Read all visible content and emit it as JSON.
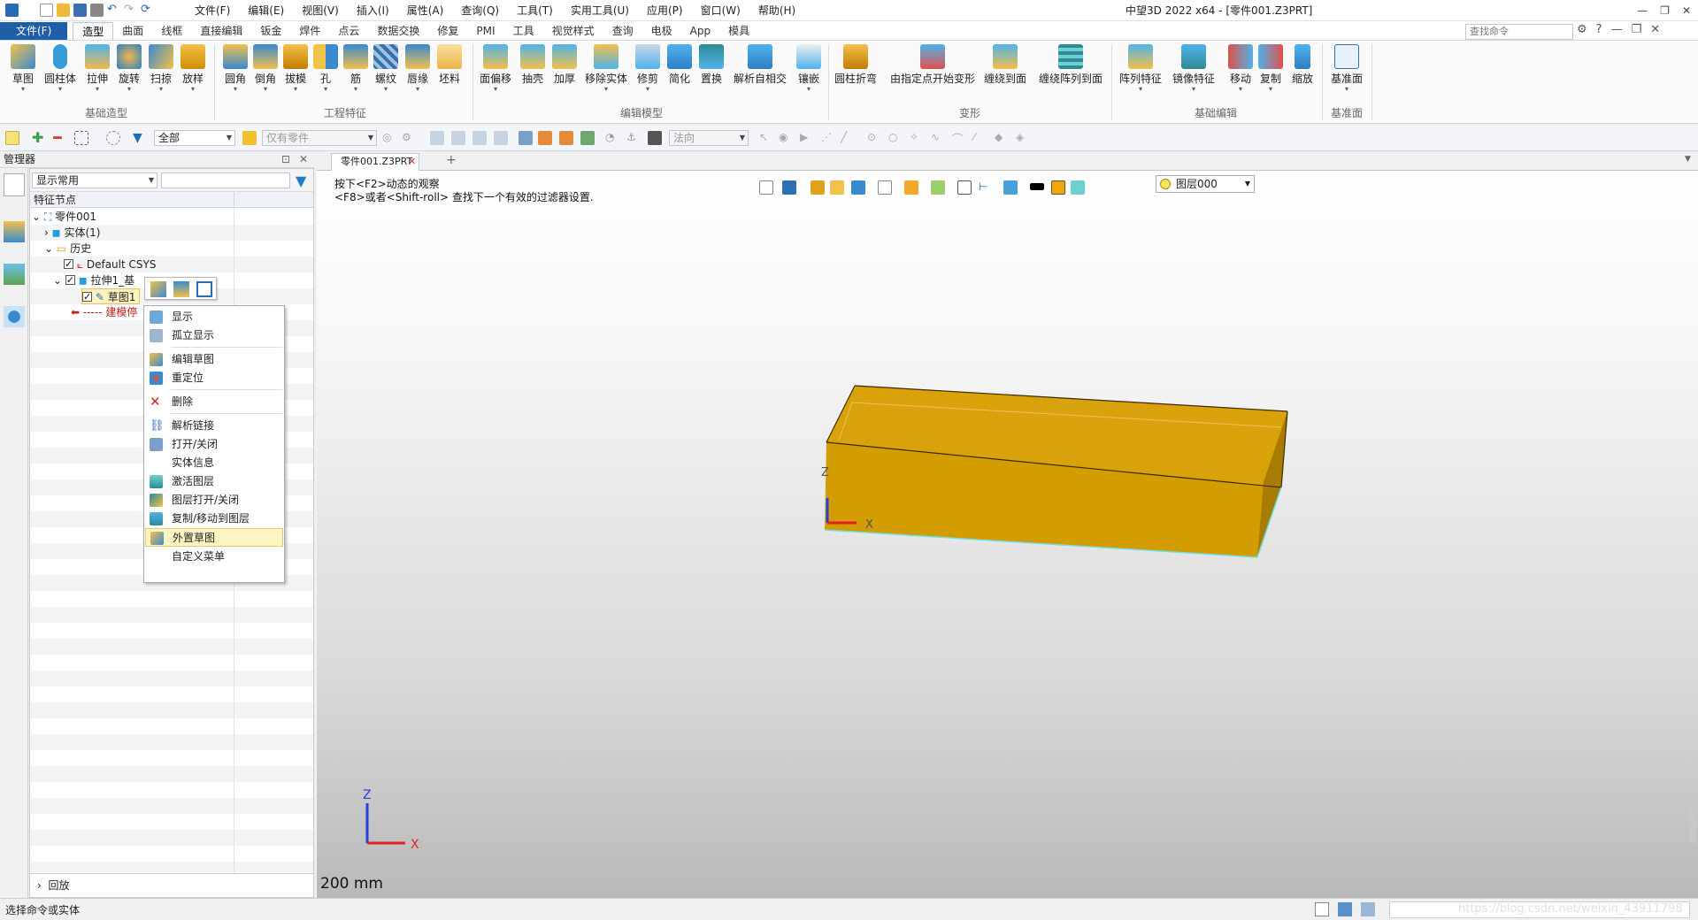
{
  "app": {
    "title": "中望3D 2022 x64 - [零件001.Z3PRT]"
  },
  "menubar": [
    "文件(F)",
    "编辑(E)",
    "视图(V)",
    "插入(I)",
    "属性(A)",
    "查询(Q)",
    "工具(T)",
    "实用工具(U)",
    "应用(P)",
    "窗口(W)",
    "帮助(H)"
  ],
  "ribbon_tabs": [
    "文件(F)",
    "造型",
    "曲面",
    "线框",
    "直接编辑",
    "钣金",
    "焊件",
    "点云",
    "数据交换",
    "修复",
    "PMI",
    "工具",
    "视觉样式",
    "查询",
    "电极",
    "App",
    "模具"
  ],
  "command_search": {
    "placeholder": "查找命令"
  },
  "ribbon": {
    "buttons": [
      "草图",
      "圆柱体",
      "拉伸",
      "旋转",
      "扫掠",
      "放样",
      "圆角",
      "倒角",
      "拔模",
      "孔",
      "筋",
      "螺纹",
      "唇缘",
      "坯料",
      "面偏移",
      "抽壳",
      "加厚",
      "移除实体",
      "修剪",
      "简化",
      "置换",
      "解析自相交",
      "镶嵌",
      "圆柱折弯",
      "由指定点开始变形",
      "缠绕到面",
      "缠绕阵列到面",
      "阵列特征",
      "镜像特征",
      "移动",
      "复制",
      "缩放",
      "基准面"
    ],
    "groups": [
      "基础造型",
      "工程特征",
      "编辑模型",
      "变形",
      "基础编辑",
      "基准面"
    ]
  },
  "toolbar2": {
    "filter_value": "全部",
    "scope_value": "仅有零件",
    "normal_value": "法向"
  },
  "manager": {
    "title": "管理器",
    "display_combo": "显示常用",
    "column_header": "特征节点",
    "tree": {
      "root": "零件001",
      "solid": "实体(1)",
      "history": "历史",
      "csys": "Default CSYS",
      "extrude": "拉伸1_基",
      "sketch": "草图1",
      "rollback": "----- 建模停"
    },
    "replay": "回放"
  },
  "context_menu": [
    "显示",
    "孤立显示",
    "编辑草图",
    "重定位",
    "删除",
    "解析链接",
    "打开/关闭",
    "实体信息",
    "激活图层",
    "图层打开/关闭",
    "复制/移动到图层",
    "外置草图",
    "自定义菜单"
  ],
  "doc_tab": "零件001.Z3PRT",
  "viewport": {
    "hint1": "按下<F2>动态的观察",
    "hint2": "<F8>或者<Shift-roll> 查找下一个有效的过滤器设置.",
    "layer": "图层000",
    "scale": "200 mm",
    "axis_x": "X",
    "axis_z": "Z"
  },
  "status": {
    "text": "选择命令或实体",
    "watermark": "https://blog.csdn.net/weixin_43911798"
  },
  "colors": {
    "accent": "#1f5fa8",
    "solid": "#d39c00",
    "highlight": "#fdf4c4"
  }
}
